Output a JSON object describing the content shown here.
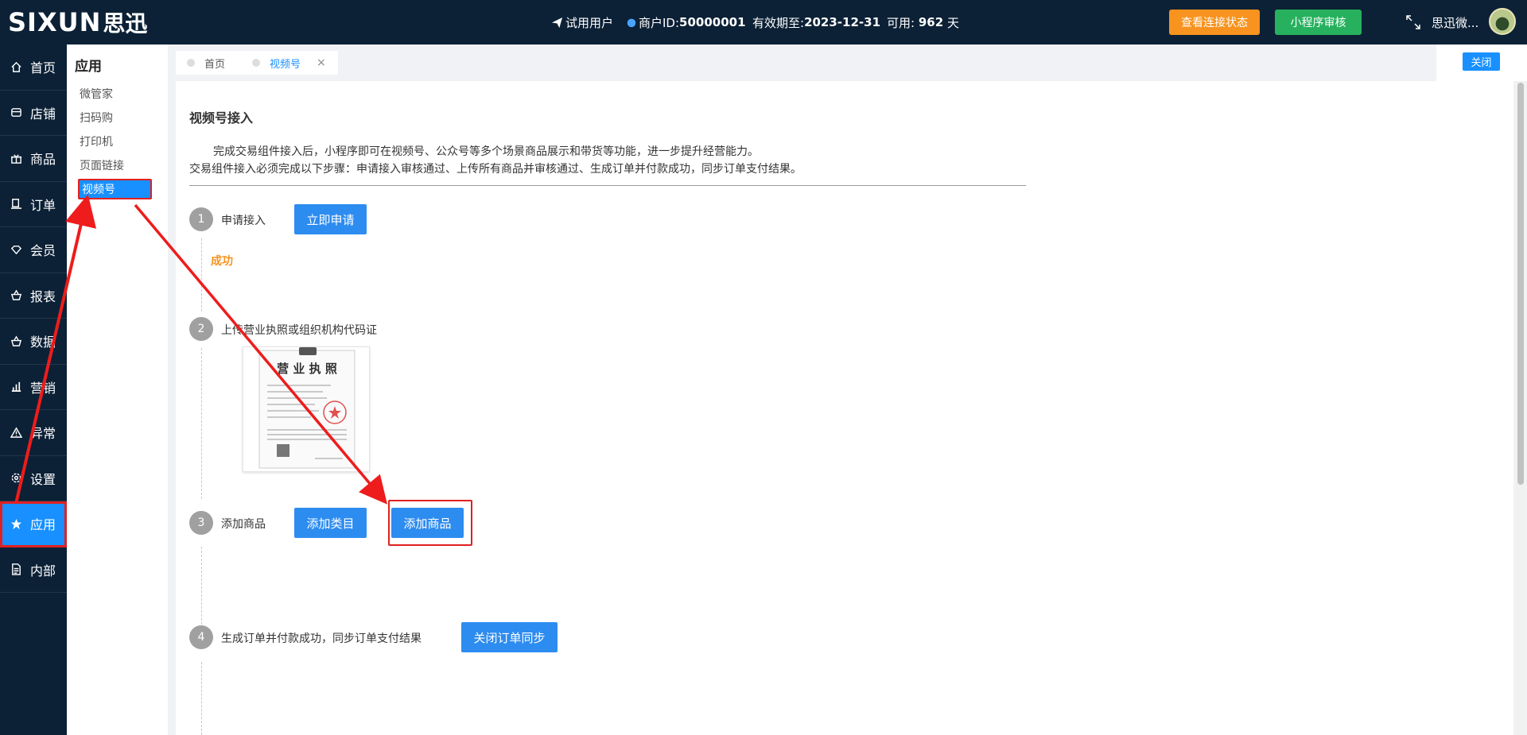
{
  "header": {
    "logo_text": "SIXUN",
    "logo_cn": "思迅",
    "user_type": "试用用户",
    "merchant_id_label": "商户ID:",
    "merchant_id": "50000001",
    "valid_until_label": "有效期至:",
    "valid_until": "2023-12-31",
    "available_label": "可用:",
    "available_days": "962",
    "days_unit": "天",
    "btn_connection": "查看连接状态",
    "btn_miniprogram": "小程序审核",
    "user_name": "思迅微..."
  },
  "nav": [
    {
      "label": "首页",
      "icon": "home-icon"
    },
    {
      "label": "店铺",
      "icon": "store-icon"
    },
    {
      "label": "商品",
      "icon": "gift-icon"
    },
    {
      "label": "订单",
      "icon": "order-icon"
    },
    {
      "label": "会员",
      "icon": "diamond-icon"
    },
    {
      "label": "报表",
      "icon": "basket-icon"
    },
    {
      "label": "数据",
      "icon": "basket-icon"
    },
    {
      "label": "营销",
      "icon": "bar-chart-icon"
    },
    {
      "label": "异常",
      "icon": "warning-icon"
    },
    {
      "label": "设置",
      "icon": "gear-icon"
    },
    {
      "label": "应用",
      "icon": "star-icon"
    },
    {
      "label": "内部",
      "icon": "document-icon"
    }
  ],
  "subnav": {
    "title": "应用",
    "items": [
      "微管家",
      "扫码购",
      "打印机",
      "页面链接",
      "视频号"
    ]
  },
  "tabs": [
    {
      "label": "首页"
    },
    {
      "label": "视频号"
    }
  ],
  "close_label": "关闭",
  "content": {
    "title": "视频号接入",
    "desc1": "完成交易组件接入后，小程序即可在视频号、公众号等多个场景商品展示和带货等功能，进一步提升经营能力。",
    "desc2": "交易组件接入必须完成以下步骤：申请接入审核通过、上传所有商品并审核通过、生成订单并付款成功，同步订单支付结果。",
    "steps": [
      {
        "num": "1",
        "label": "申请接入",
        "buttons": [
          "立即申请"
        ],
        "status": "成功"
      },
      {
        "num": "2",
        "label": "上传营业执照或组织机构代码证",
        "image_title": "营 业 执 照"
      },
      {
        "num": "3",
        "label": "添加商品",
        "buttons": [
          "添加类目",
          "添加商品"
        ]
      },
      {
        "num": "4",
        "label": "生成订单并付款成功，同步订单支付结果",
        "buttons": [
          "关闭订单同步"
        ]
      }
    ]
  },
  "colors": {
    "header_bg": "#0c2136",
    "primary": "#1890ff",
    "button_blue": "#2d8cf0",
    "orange": "#f7931e",
    "green": "#27b15e",
    "annotation_red": "#e02020"
  }
}
